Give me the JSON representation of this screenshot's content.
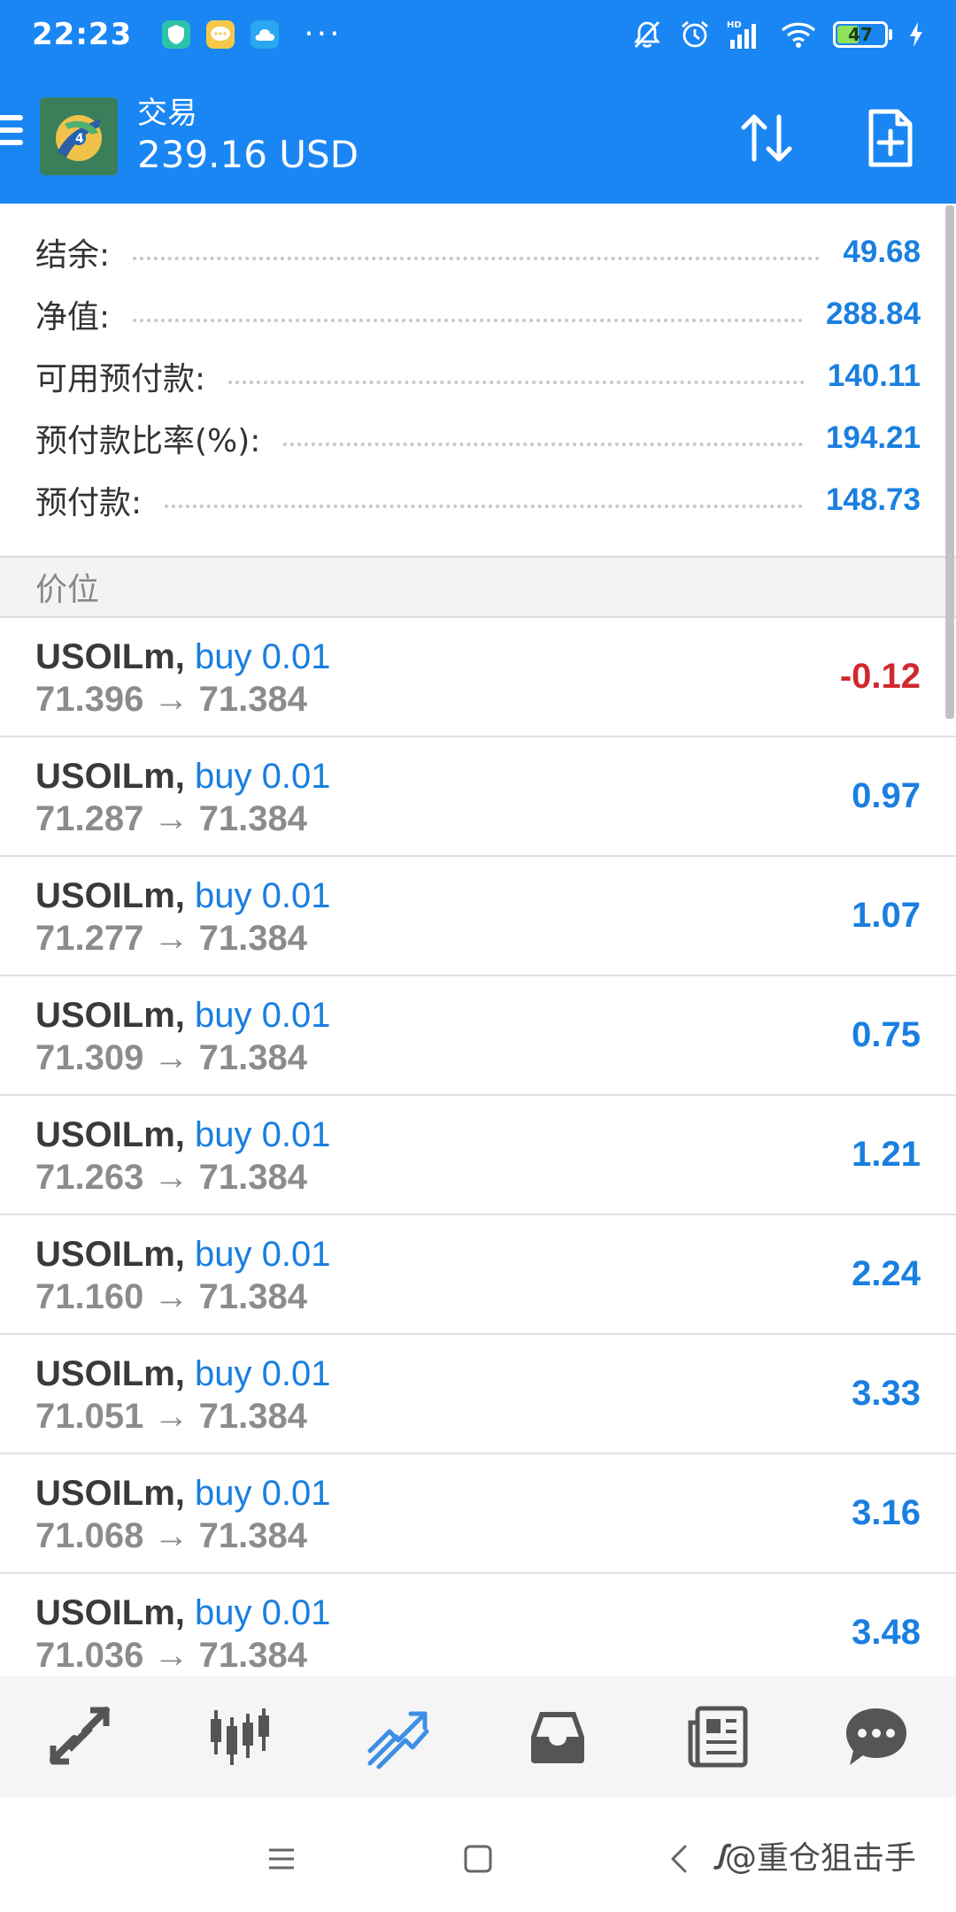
{
  "status_bar": {
    "time": "22:23",
    "apps": [
      "shield-app-icon",
      "chat-app-icon",
      "cloud-app-icon"
    ],
    "more": "···",
    "battery_level": "47"
  },
  "app_bar": {
    "title": "交易",
    "balance": "239.16 USD",
    "background": "#1a86f3"
  },
  "summary": [
    {
      "label": "结余:",
      "value": "49.68"
    },
    {
      "label": "净值:",
      "value": "288.84"
    },
    {
      "label": "可用预付款:",
      "value": "140.11"
    },
    {
      "label": "预付款比率(%):",
      "value": "194.21"
    },
    {
      "label": "预付款:",
      "value": "148.73"
    }
  ],
  "positions_header": "价位",
  "positions": [
    {
      "symbol": "USOILm,",
      "side": "buy 0.01",
      "open": "71.396",
      "arrow": "→",
      "current": "71.384",
      "profit": "-0.12"
    },
    {
      "symbol": "USOILm,",
      "side": "buy 0.01",
      "open": "71.287",
      "arrow": "→",
      "current": "71.384",
      "profit": "0.97"
    },
    {
      "symbol": "USOILm,",
      "side": "buy 0.01",
      "open": "71.277",
      "arrow": "→",
      "current": "71.384",
      "profit": "1.07"
    },
    {
      "symbol": "USOILm,",
      "side": "buy 0.01",
      "open": "71.309",
      "arrow": "→",
      "current": "71.384",
      "profit": "0.75"
    },
    {
      "symbol": "USOILm,",
      "side": "buy 0.01",
      "open": "71.263",
      "arrow": "→",
      "current": "71.384",
      "profit": "1.21"
    },
    {
      "symbol": "USOILm,",
      "side": "buy 0.01",
      "open": "71.160",
      "arrow": "→",
      "current": "71.384",
      "profit": "2.24"
    },
    {
      "symbol": "USOILm,",
      "side": "buy 0.01",
      "open": "71.051",
      "arrow": "→",
      "current": "71.384",
      "profit": "3.33"
    },
    {
      "symbol": "USOILm,",
      "side": "buy 0.01",
      "open": "71.068",
      "arrow": "→",
      "current": "71.384",
      "profit": "3.16"
    },
    {
      "symbol": "USOILm,",
      "side": "buy 0.01",
      "open": "71.036",
      "arrow": "→",
      "current": "71.384",
      "profit": "3.48"
    }
  ],
  "bottom_nav": [
    {
      "icon": "quotes-icon",
      "active": false
    },
    {
      "icon": "chart-icon",
      "active": false
    },
    {
      "icon": "trade-icon",
      "active": true
    },
    {
      "icon": "history-icon",
      "active": false
    },
    {
      "icon": "news-icon",
      "active": false
    },
    {
      "icon": "messages-icon",
      "active": false
    }
  ],
  "watermark": "@重仓狙击手",
  "colors": {
    "accent": "#1a86f3",
    "value_blue": "#1a7fe0",
    "loss_red": "#d0282e",
    "nav_active": "#3d8fe6",
    "nav_inactive": "#555555"
  }
}
